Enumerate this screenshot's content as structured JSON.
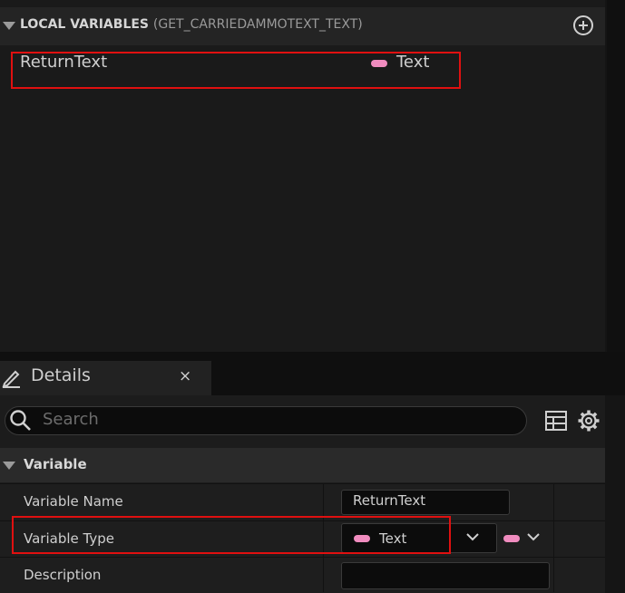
{
  "local_variables": {
    "title": "LOCAL VARIABLES",
    "subtitle": "(GET_CARRIEDAMMOTEXT_TEXT)",
    "items": [
      {
        "name": "ReturnText",
        "type": "Text"
      }
    ]
  },
  "details": {
    "tab_title": "Details",
    "close_glyph": "×",
    "search": {
      "placeholder": "Search",
      "value": ""
    },
    "category": "Variable",
    "properties": {
      "variable_name": {
        "label": "Variable Name",
        "value": "ReturnText"
      },
      "variable_type": {
        "label": "Variable Type",
        "value": "Text"
      },
      "description": {
        "label": "Description",
        "value": ""
      }
    }
  },
  "colors": {
    "text_pin": "#f08cbf",
    "highlight": "#e01010"
  },
  "icons": [
    "add-icon",
    "pencil-icon",
    "close-icon",
    "search-icon",
    "table-icon",
    "gear-icon",
    "chevron-down-icon",
    "triangle-down-icon"
  ]
}
